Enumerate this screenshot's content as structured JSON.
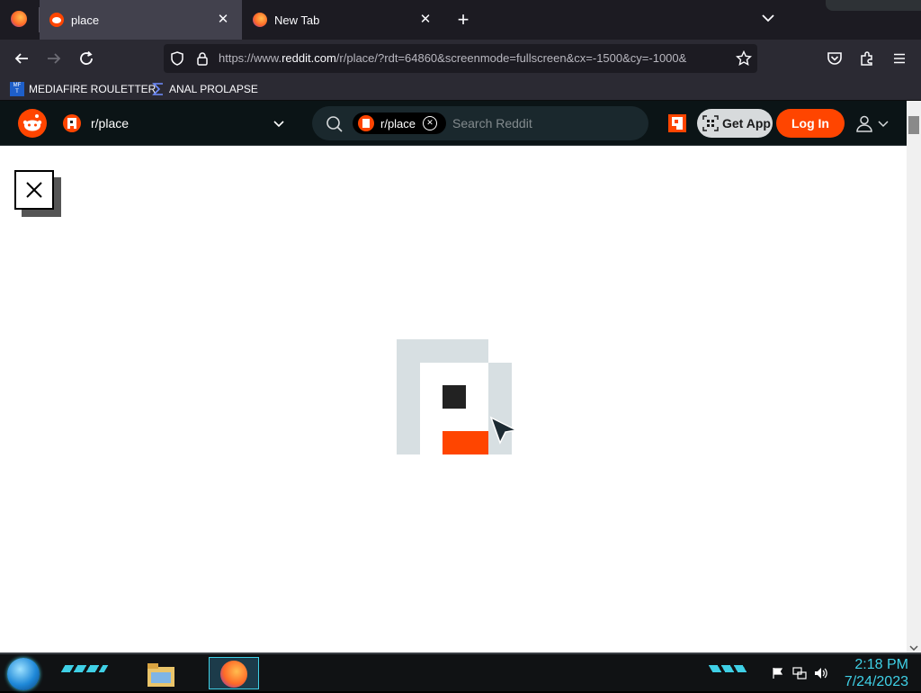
{
  "browser": {
    "tabs": [
      {
        "title": "place"
      },
      {
        "title": "New Tab"
      }
    ],
    "url_prefix": "https://www.",
    "url_domain": "reddit.com",
    "url_rest": "/r/place/?rdt=64860&screenmode=fullscreen&cx=-1500&cy=-1000&",
    "bookmarks": [
      {
        "label": "MEDIAFIRE ROULETTER"
      },
      {
        "label": "ANAL PROLAPSE"
      }
    ]
  },
  "reddit": {
    "community": "r/place",
    "search_chip": "r/place",
    "search_placeholder": "Search Reddit",
    "get_app_label": "Get App",
    "login_label": "Log In"
  },
  "taskbar": {
    "time": "2:18 PM",
    "date": "7/24/2023"
  },
  "colors": {
    "reddit_orange": "#ff4500",
    "page_bg": "#ffffff",
    "loader_gray": "#d7dfe2",
    "clock_cyan": "#3fd0e6"
  }
}
